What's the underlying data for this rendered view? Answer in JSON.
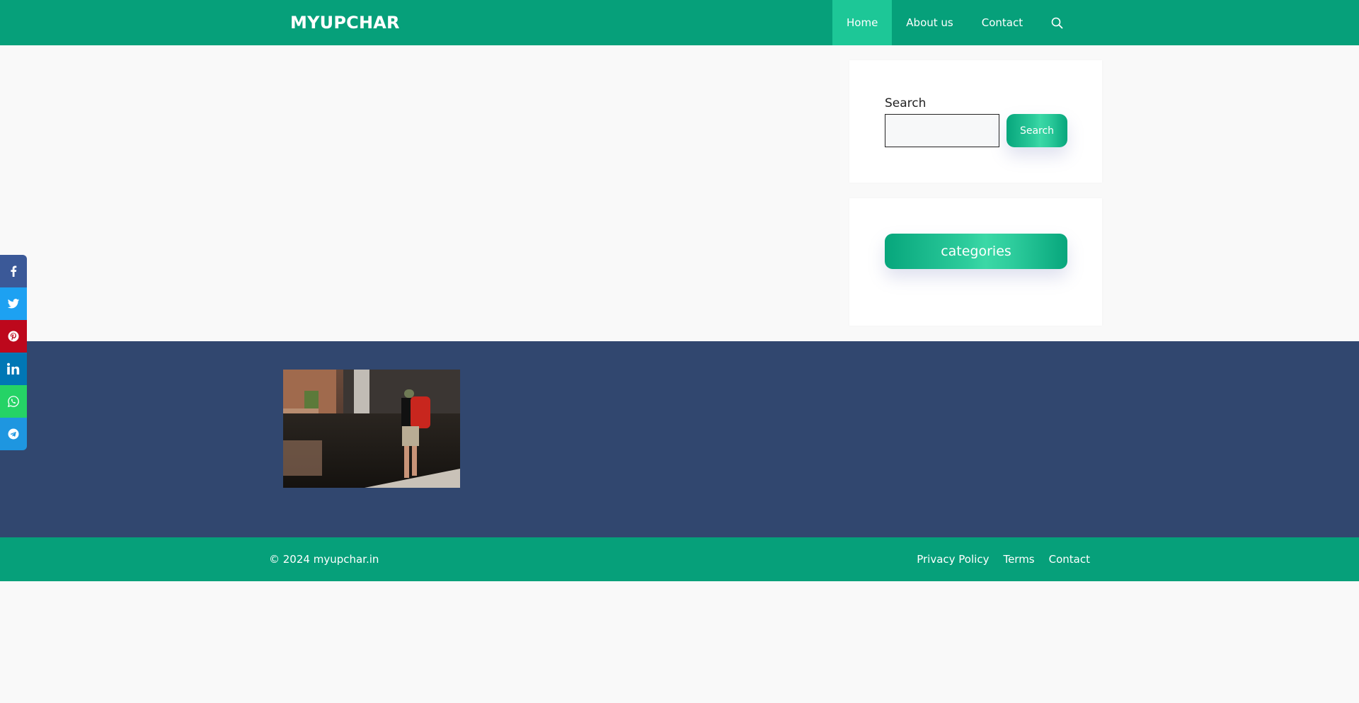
{
  "header": {
    "site_title": "MYUPCHAR",
    "brand_color": "#06A07A",
    "nav": [
      {
        "label": "Home",
        "active": true
      },
      {
        "label": "About us",
        "active": false
      },
      {
        "label": "Contact",
        "active": false
      }
    ],
    "search_icon": "search-icon"
  },
  "sidebar": {
    "search_widget": {
      "label": "Search",
      "input_value": "",
      "input_placeholder": "",
      "button_label": "Search"
    },
    "categories_widget": {
      "button_label": "categories"
    }
  },
  "social_share": [
    {
      "name": "facebook",
      "icon": "facebook-icon",
      "color": "#3B5998"
    },
    {
      "name": "twitter",
      "icon": "twitter-icon",
      "color": "#1DA1F2"
    },
    {
      "name": "pinterest",
      "icon": "pinterest-icon",
      "color": "#BD081C"
    },
    {
      "name": "linkedin",
      "icon": "linkedin-icon",
      "color": "#0077B5"
    },
    {
      "name": "whatsapp",
      "icon": "whatsapp-icon",
      "color": "#25D366"
    },
    {
      "name": "telegram",
      "icon": "telegram-icon",
      "color": "#1E96E0"
    }
  ],
  "footer": {
    "image_alt": "Hiker with red backpack at waterfall pool",
    "copyright": "© 2024 myupchar.in",
    "links": [
      "Privacy Policy",
      "Terms",
      "Contact"
    ],
    "widgets_bg": "#31476F"
  }
}
